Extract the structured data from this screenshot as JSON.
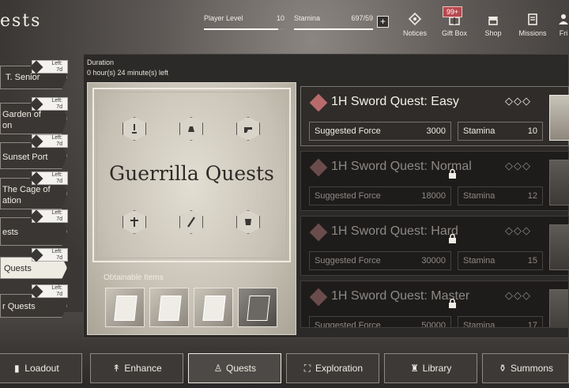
{
  "header": {
    "title": "ests",
    "player_level_label": "Player Level",
    "player_level_value": "10",
    "player_level_fill": 0.92,
    "stamina_label": "Stamina",
    "stamina_value": "697/59",
    "stamina_fill": 1.0,
    "plus": "+",
    "gift_badge": "99+",
    "nav": [
      {
        "label": "Notices",
        "icon": "notice-icon"
      },
      {
        "label": "Gift Box",
        "icon": "gift-icon"
      },
      {
        "label": "Shop",
        "icon": "shop-icon"
      },
      {
        "label": "Missions",
        "icon": "missions-icon"
      },
      {
        "label": "Fri",
        "icon": "friends-icon"
      }
    ]
  },
  "left_list": [
    {
      "label": "T. Senior",
      "tag_top": "Left:",
      "tag_bottom": "7d"
    },
    {
      "label": "Garden of",
      "label2": "on",
      "tag_top": "Left:",
      "tag_bottom": "7d"
    },
    {
      "label": "Sunset Port",
      "tag_top": "Left:",
      "tag_bottom": "7d"
    },
    {
      "label": "The Cage of",
      "label2": "ation",
      "tag_top": "Left:",
      "tag_bottom": "7d"
    },
    {
      "label": "ests",
      "tag_top": "Left:",
      "tag_bottom": "7d"
    },
    {
      "label": "Quests",
      "tag_top": "Left:",
      "tag_bottom": "7d"
    },
    {
      "label": "r Quests",
      "tag_top": "Left:",
      "tag_bottom": "7d"
    }
  ],
  "duration": {
    "label": "Duration",
    "value": "0 hour(s) 24 minute(s) left"
  },
  "banner": {
    "title": "Guerrilla Quests",
    "items_label": "Obtainable Items"
  },
  "quests": [
    {
      "title": "1H Sword Quest: Easy",
      "stars": "◇◇◇",
      "force_label": "Suggested Force",
      "force": "3000",
      "stamina_label": "Stamina",
      "stamina": "10",
      "locked": false
    },
    {
      "title": "1H Sword Quest: Normal",
      "stars": "◇◇◇",
      "force_label": "Suggested Force",
      "force": "18000",
      "stamina_label": "Stamina",
      "stamina": "12",
      "locked": true
    },
    {
      "title": "1H Sword Quest: Hard",
      "stars": "◇◇◇",
      "force_label": "Suggested Force",
      "force": "30000",
      "stamina_label": "Stamina",
      "stamina": "15",
      "locked": true
    },
    {
      "title": "1H Sword Quest: Master",
      "stars": "◇◇◇",
      "force_label": "Suggested Force",
      "force": "50000",
      "stamina_label": "Stamina",
      "stamina": "17",
      "locked": true
    }
  ],
  "tabs": [
    {
      "label": "Loadout",
      "icon": "loadout-icon"
    },
    {
      "label": "Enhance",
      "icon": "enhance-icon"
    },
    {
      "label": "Quests",
      "icon": "quests-icon",
      "active": true
    },
    {
      "label": "Exploration",
      "icon": "exploration-icon"
    },
    {
      "label": "Library",
      "icon": "library-icon"
    },
    {
      "label": "Summons",
      "icon": "summons-icon"
    }
  ],
  "colors": {
    "accent_badge": "#b8484e",
    "quest_icon": "#b86b6b"
  }
}
